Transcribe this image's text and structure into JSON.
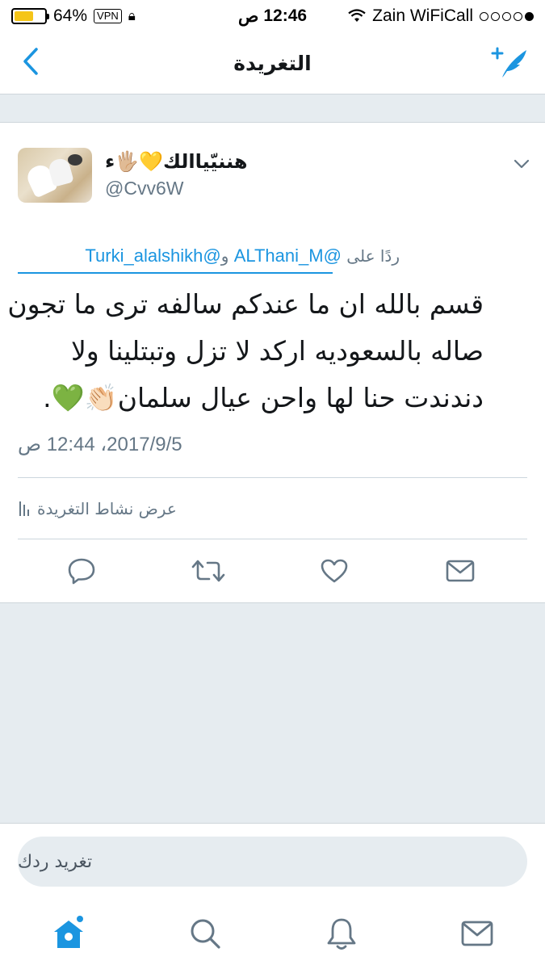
{
  "status_bar": {
    "battery_percent": "64%",
    "battery_level": 0.64,
    "vpn": "VPN",
    "time": "12:46",
    "ampm": "ص",
    "carrier": "Zain WiFiCall"
  },
  "nav": {
    "title": "التغريدة",
    "back_icon": "chevron-left-icon",
    "compose_icon": "compose-tweet-icon"
  },
  "tweet": {
    "user_name": "هننيّياالك💛🖐🏼ء",
    "user_handle": "@Cvv6W",
    "reply_prefix": "ردًا على",
    "reply_mention_1": "@ALThani_M",
    "reply_and": "و",
    "reply_mention_2": "@Turki_alalshikh",
    "text_lines": [
      "قسم بالله ان ما عندكم سالفه ترى ما تجون",
      "صاله بالسعوديه اركد لا تزل وتبتلينا ولا",
      "دندندت حنا لها واحن عيال سلمان👏🏻💚."
    ],
    "timestamp": "2017/9/5، 12:44 ص",
    "activity_label": "عرض نشاط التغريدة"
  },
  "actions": {
    "reply_icon": "reply-icon",
    "retweet_icon": "retweet-icon",
    "like_icon": "heart-icon",
    "share_icon": "mail-icon"
  },
  "reply_box": {
    "placeholder": "تغريد ردك"
  },
  "tabbar": {
    "home_icon": "home-icon",
    "search_icon": "search-icon",
    "notifications_icon": "bell-icon",
    "messages_icon": "mail-icon"
  },
  "colors": {
    "accent": "#1b95e0",
    "muted": "#657786",
    "background_gray": "#e6ecf0",
    "battery": "#f5c518"
  }
}
